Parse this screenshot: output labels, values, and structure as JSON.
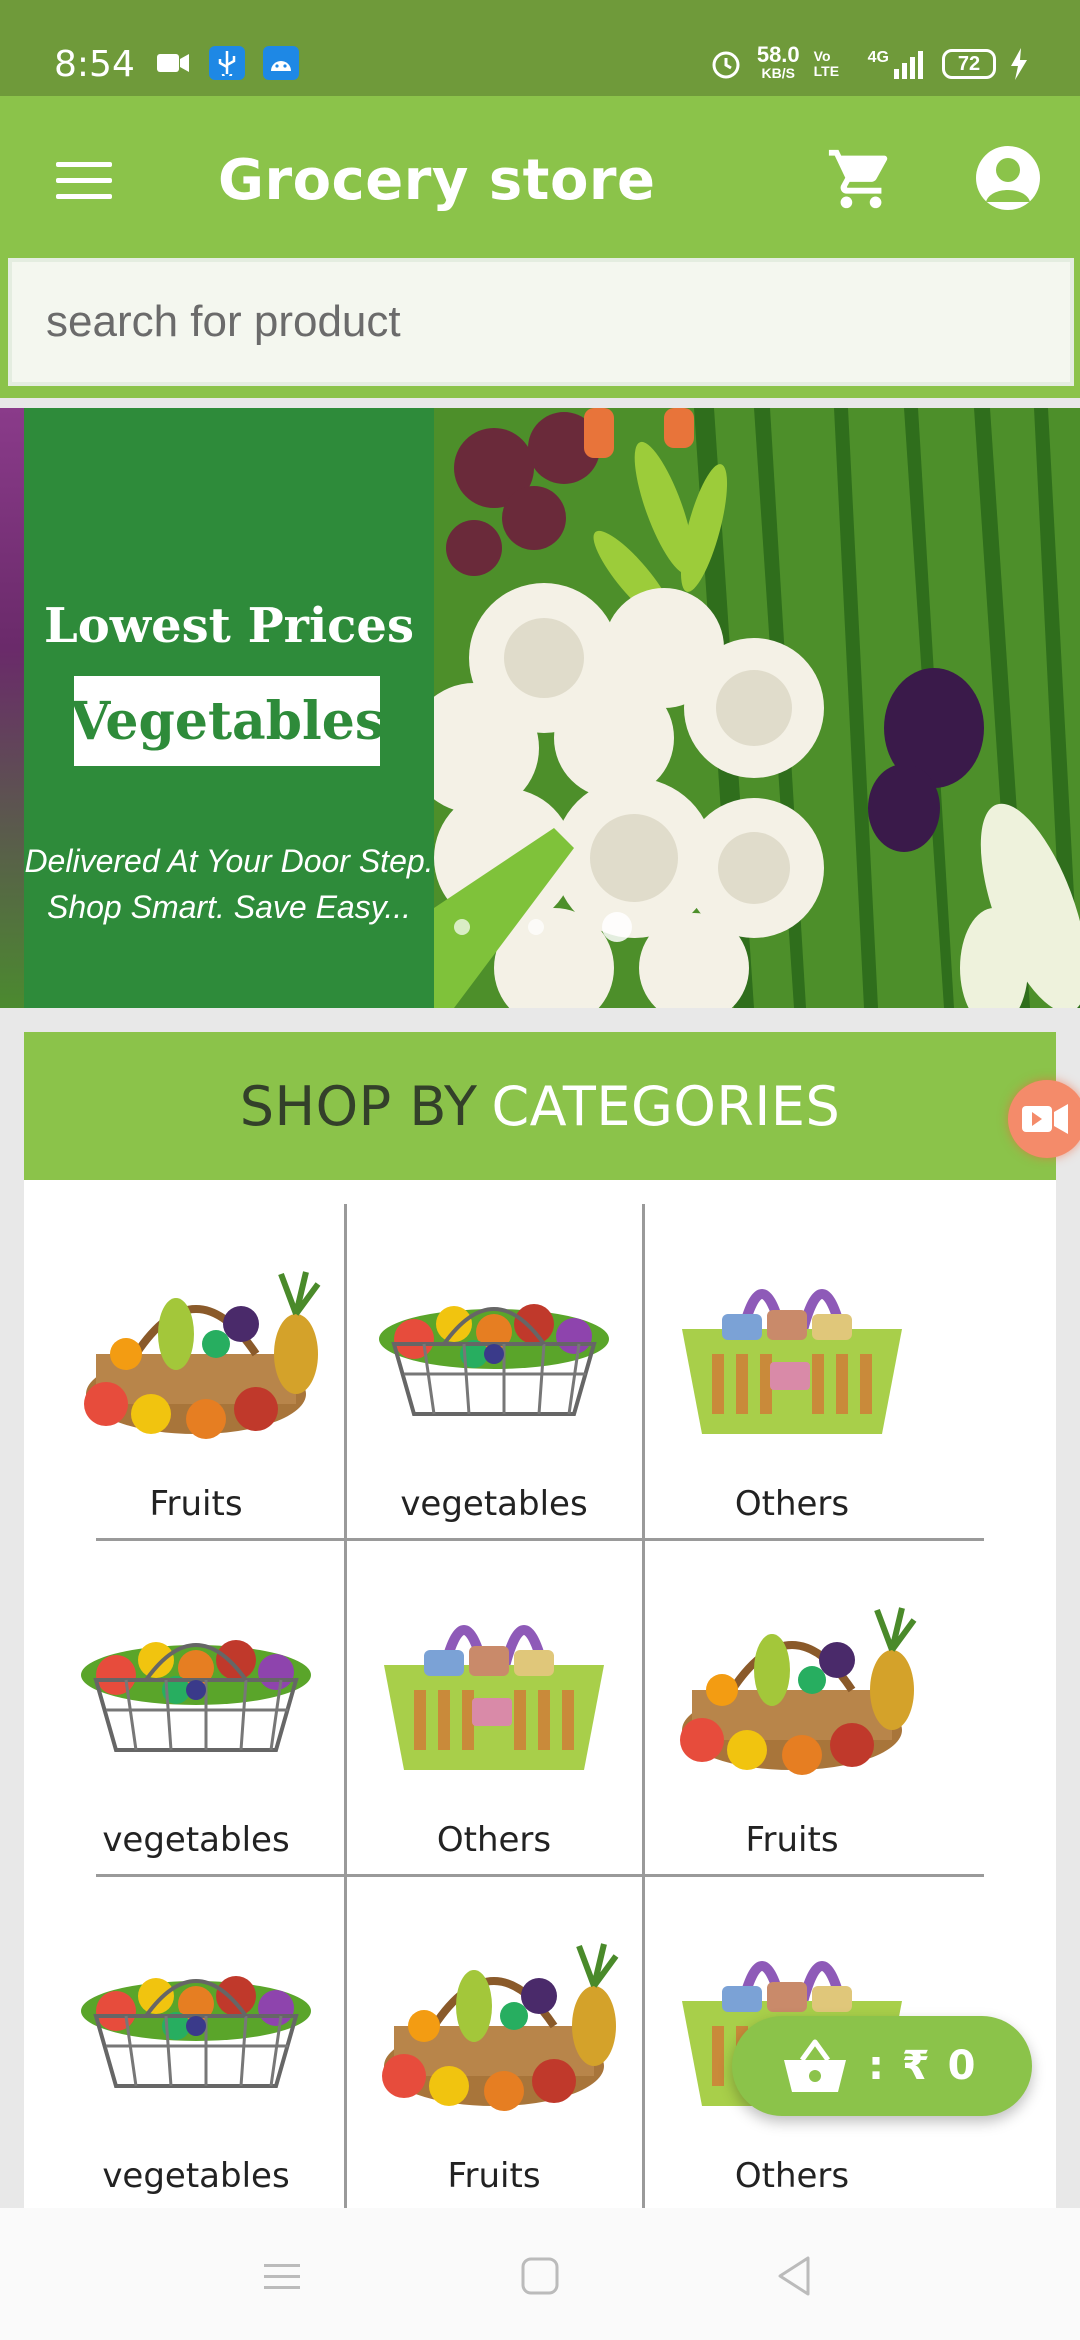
{
  "status_bar": {
    "time": "8:54",
    "net_speed": "58.0",
    "net_unit": "KB/S",
    "volte": "Vo LTE",
    "network": "4G",
    "battery": "72"
  },
  "appbar": {
    "title": "Grocery store",
    "menu_icon": "menu-icon",
    "cart_icon": "cart-icon",
    "account_icon": "account-icon"
  },
  "search": {
    "placeholder": "search for product",
    "value": ""
  },
  "banner": {
    "title": "Lowest Prices",
    "highlight": "Vegetables",
    "subtitle_line1": "Delivered At Your Door Step.",
    "subtitle_line2": "Shop Smart. Save Easy...",
    "slide_count": 3,
    "active_slide": 3
  },
  "categories": {
    "heading_part1": "SHOP BY",
    "heading_part2": "CATEGORIES",
    "items": [
      {
        "label": "Fruits",
        "image": "fruit-basket"
      },
      {
        "label": "vegetables",
        "image": "vegetable-basket"
      },
      {
        "label": "Others",
        "image": "grocery-basket"
      },
      {
        "label": "vegetables",
        "image": "vegetable-basket"
      },
      {
        "label": "Others",
        "image": "grocery-basket"
      },
      {
        "label": "Fruits",
        "image": "fruit-basket"
      },
      {
        "label": "vegetables",
        "image": "vegetable-basket"
      },
      {
        "label": "Fruits",
        "image": "fruit-basket"
      },
      {
        "label": "Others",
        "image": "grocery-basket"
      }
    ]
  },
  "floating_cart": {
    "text": ": ₹ 0",
    "icon": "basket-icon"
  },
  "colors": {
    "primary": "#8bc34a",
    "status_bar": "#6f9a3a",
    "banner_green": "#2e8b3a"
  }
}
